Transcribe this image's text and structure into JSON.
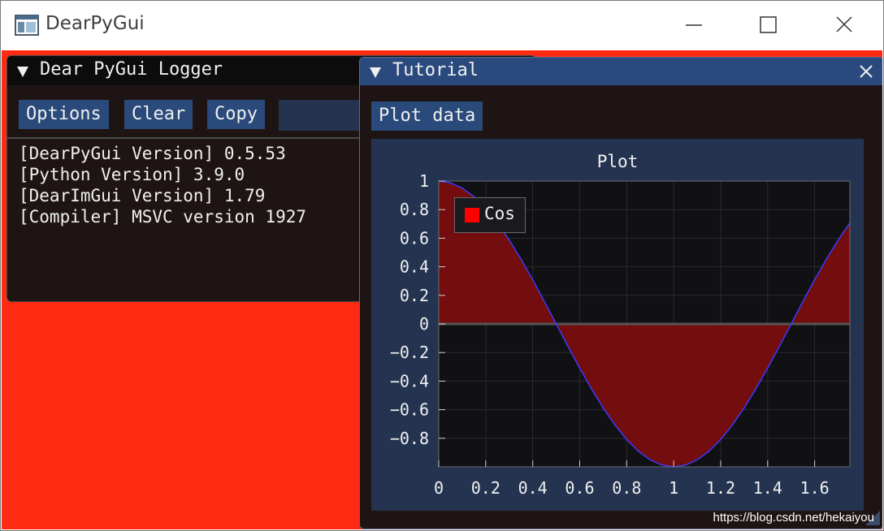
{
  "window": {
    "title": "DearPyGui"
  },
  "logger": {
    "title": "Dear PyGui Logger",
    "buttons": [
      "Options",
      "Clear",
      "Copy"
    ],
    "lines": [
      "[DearPyGui Version] 0.5.53",
      "[Python Version] 3.9.0",
      "[DearImGui Version] 1.79",
      "[Compiler] MSVC version 1927"
    ]
  },
  "tutorial": {
    "title": "Tutorial",
    "button": "Plot data",
    "plot_title": "Plot",
    "legend_label": "Cos"
  },
  "chart_data": {
    "type": "area",
    "title": "Plot",
    "series": [
      {
        "name": "Cos",
        "color": "#ff0000",
        "x": [
          0,
          0.05,
          0.1,
          0.15,
          0.2,
          0.25,
          0.3,
          0.35,
          0.4,
          0.45,
          0.5,
          0.55,
          0.6,
          0.65,
          0.7,
          0.75,
          0.8,
          0.85,
          0.9,
          0.95,
          1.0,
          1.05,
          1.1,
          1.15,
          1.2,
          1.25,
          1.3,
          1.35,
          1.4,
          1.45,
          1.5,
          1.55,
          1.6,
          1.65,
          1.7,
          1.75
        ],
        "y": [
          1.0,
          0.9877,
          0.9511,
          0.891,
          0.809,
          0.7071,
          0.5878,
          0.454,
          0.309,
          0.1564,
          0.0,
          -0.1564,
          -0.309,
          -0.454,
          -0.5878,
          -0.7071,
          -0.809,
          -0.891,
          -0.9511,
          -0.9877,
          -1.0,
          -0.9877,
          -0.9511,
          -0.891,
          -0.809,
          -0.7071,
          -0.5878,
          -0.454,
          -0.309,
          -0.1564,
          0.0,
          0.1564,
          0.309,
          0.454,
          0.5878,
          0.7071
        ]
      }
    ],
    "xlim": [
      0,
      1.75
    ],
    "ylim": [
      -1,
      1
    ],
    "xticks": [
      0,
      0.2,
      0.4,
      0.6,
      0.8,
      1,
      1.2,
      1.4,
      1.6
    ],
    "xtick_labels": [
      "0",
      "0.2",
      "0.4",
      "0.6",
      "0.8",
      "1",
      "1.2",
      "1.4",
      "1.6"
    ],
    "yticks": [
      1,
      0.8,
      0.6,
      0.4,
      0.2,
      0,
      -0.2,
      -0.4,
      -0.6,
      -0.8
    ],
    "ytick_labels": [
      "1",
      "0.8",
      "0.6",
      "0.4",
      "0.2",
      "0",
      "−0.2",
      "−0.4",
      "−0.6",
      "−0.8"
    ],
    "grid": true,
    "legend": "top-left"
  },
  "watermark": "https://blog.csdn.net/hekaiyou",
  "colors": {
    "background": "#ff2a12",
    "button": "#294a7a",
    "title_active": "#2a4a7e",
    "plot_fill": "#7a0e0e",
    "plot_line": "#3a3aff"
  }
}
